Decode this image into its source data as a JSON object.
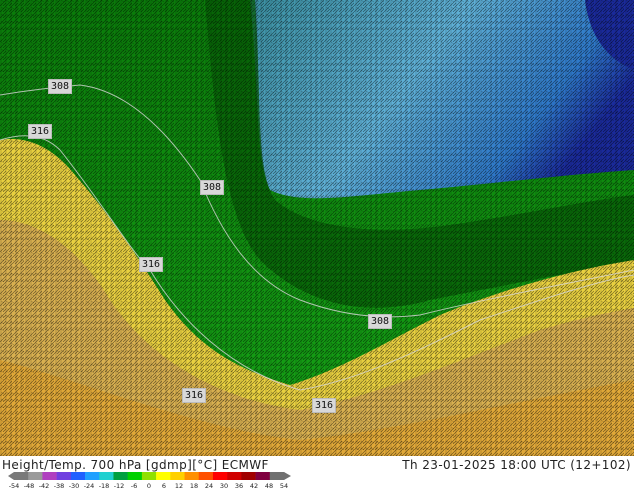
{
  "title": {
    "variable": "Height/Temp. 700 hPa [gdmp][°C]",
    "model": "ECMWF"
  },
  "valid_time": "Th 23-01-2025 18:00 UTC (12+102)",
  "contour_labels": [
    "308",
    "316",
    "308",
    "316",
    "308",
    "316",
    "316"
  ],
  "colorbar": {
    "ticks": [
      "-54",
      "-48",
      "-42",
      "-38",
      "-30",
      "-24",
      "-18",
      "-12",
      "-6",
      "0",
      "6",
      "12",
      "18",
      "24",
      "30",
      "36",
      "42",
      "48",
      "54"
    ],
    "colors": [
      "#7a7a7a",
      "#9a9a9a",
      "#b040c0",
      "#7040e0",
      "#2060ff",
      "#20a0ff",
      "#20d0d0",
      "#00a040",
      "#00d000",
      "#90e000",
      "#ffff00",
      "#ffd000",
      "#ff9000",
      "#ff5000",
      "#ff0000",
      "#d00000",
      "#a00000",
      "#800040",
      "#707070"
    ]
  },
  "map_colors": {
    "yellow": "#e8d040",
    "dark_yellow": "#c0a830",
    "green": "#0c8a0c",
    "dark_green": "#075c07",
    "teal": "#3a8fa0",
    "light_blue": "#5fb0d6",
    "blue": "#2060b8",
    "dark_blue": "#1a2a9a",
    "orange_tan": "#d8b050"
  }
}
